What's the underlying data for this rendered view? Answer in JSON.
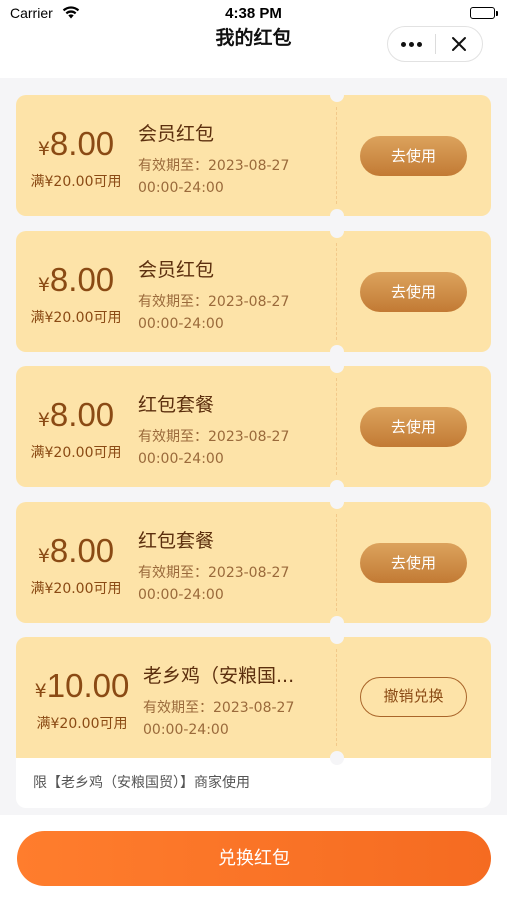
{
  "status_bar": {
    "carrier": "Carrier",
    "time": "4:38 PM"
  },
  "nav": {
    "title": "我的红包"
  },
  "coupons": [
    {
      "currency": "¥",
      "amount": "8.00",
      "condition": "满¥20.00可用",
      "name": "会员红包",
      "valid_label": "有效期至：",
      "valid_date": "2023-08-27",
      "valid_time": "00:00-24:00",
      "action": "去使用"
    },
    {
      "currency": "¥",
      "amount": "8.00",
      "condition": "满¥20.00可用",
      "name": "会员红包",
      "valid_label": "有效期至：",
      "valid_date": "2023-08-27",
      "valid_time": "00:00-24:00",
      "action": "去使用"
    },
    {
      "currency": "¥",
      "amount": "8.00",
      "condition": "满¥20.00可用",
      "name": "红包套餐",
      "valid_label": "有效期至：",
      "valid_date": "2023-08-27",
      "valid_time": "00:00-24:00",
      "action": "去使用"
    },
    {
      "currency": "¥",
      "amount": "8.00",
      "condition": "满¥20.00可用",
      "name": "红包套餐",
      "valid_label": "有效期至：",
      "valid_date": "2023-08-27",
      "valid_time": "00:00-24:00",
      "action": "去使用"
    },
    {
      "currency": "¥",
      "amount": "10.00",
      "condition": "满¥20.00可用",
      "name": "老乡鸡（安粮国...",
      "valid_label": "有效期至：",
      "valid_date": "2023-08-27",
      "valid_time": "00:00-24:00",
      "action": "撤销兑换",
      "restriction": "限【老乡鸡（安粮国贸）】商家使用"
    }
  ],
  "bottom": {
    "exchange_label": "兑换红包"
  },
  "colors": {
    "coupon_bg": "#fde3a8",
    "accent_orange": "#f56b21",
    "amount_brown": "#8a4a14"
  }
}
